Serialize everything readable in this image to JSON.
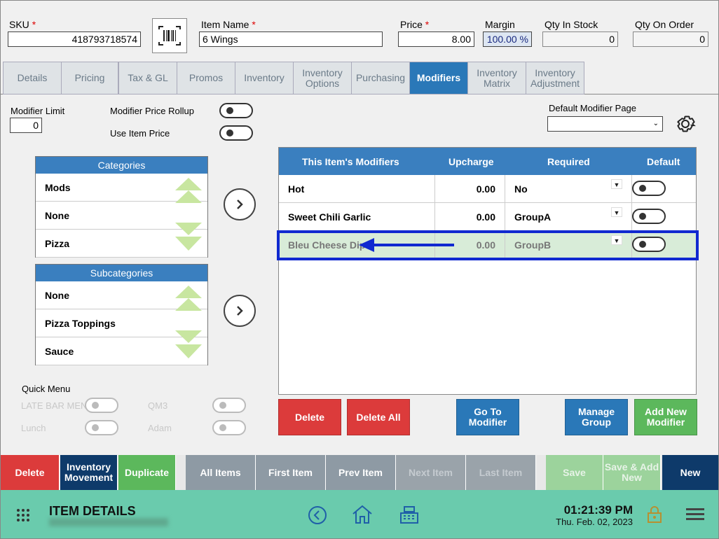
{
  "header": {
    "sku_label": "SKU",
    "sku_value": "418793718574",
    "name_label": "Item Name",
    "name_value": "6 Wings",
    "price_label": "Price",
    "price_value": "8.00",
    "margin_label": "Margin",
    "margin_value": "100.00 %",
    "qty_stock_label": "Qty In Stock",
    "qty_stock_value": "0",
    "qty_order_label": "Qty On Order",
    "qty_order_value": "0",
    "required_mark": "*"
  },
  "tabs": [
    {
      "label": "Details"
    },
    {
      "label": "Pricing"
    },
    {
      "label": "Tax & GL"
    },
    {
      "label": "Promos"
    },
    {
      "label": "Inventory"
    },
    {
      "label": "Inventory Options"
    },
    {
      "label": "Purchasing"
    },
    {
      "label": "Modifiers",
      "active": true
    },
    {
      "label": "Inventory Matrix"
    },
    {
      "label": "Inventory Adjustment"
    }
  ],
  "settings": {
    "modifier_limit_label": "Modifier Limit",
    "modifier_limit_value": "0",
    "price_rollup_label": "Modifier Price Rollup",
    "use_item_price_label": "Use Item Price",
    "default_page_label": "Default Modifier Page",
    "default_page_value": ""
  },
  "categories": {
    "title": "Categories",
    "items": [
      "Mods",
      "None",
      "Pizza"
    ]
  },
  "subcategories": {
    "title": "Subcategories",
    "items": [
      "None",
      "Pizza Toppings",
      "Sauce"
    ]
  },
  "quick_menu": {
    "title": "Quick Menu",
    "items": [
      "LATE BAR MENU",
      "QM3",
      "Lunch",
      "Adam"
    ]
  },
  "modifiers_grid": {
    "headers": [
      "This Item's Modifiers",
      "Upcharge",
      "Required",
      "Default"
    ],
    "rows": [
      {
        "name": "Hot",
        "upcharge": "0.00",
        "required": "No"
      },
      {
        "name": "Sweet Chili Garlic",
        "upcharge": "0.00",
        "required": "GroupA"
      },
      {
        "name": "Bleu Cheese Dip",
        "upcharge": "0.00",
        "required": "GroupB"
      }
    ]
  },
  "actions": {
    "delete": "Delete",
    "delete_all": "Delete All",
    "go_to_modifier": "Go To Modifier",
    "manage_group": "Manage Group",
    "add_new_modifier": "Add New Modifier"
  },
  "bottom_bar": {
    "delete": "Delete",
    "inventory_movement": "Inventory Movement",
    "duplicate": "Duplicate",
    "all_items": "All Items",
    "first_item": "First Item",
    "prev_item": "Prev Item",
    "next_item": "Next Item",
    "last_item": "Last Item",
    "save": "Save",
    "save_add_new": "Save & Add New",
    "new": "New"
  },
  "footer": {
    "title": "ITEM DETAILS",
    "time": "01:21:39 PM",
    "date": "Thu. Feb. 02, 2023"
  },
  "colors": {
    "tab_active": "#2a78b8",
    "header_blue": "#3a7fbf",
    "delete_red": "#dc3b3b",
    "add_green": "#5cb85c",
    "footer_green": "#6acbad",
    "highlight_blue": "#1029d0",
    "arrow_green": "#c8e6a0"
  }
}
